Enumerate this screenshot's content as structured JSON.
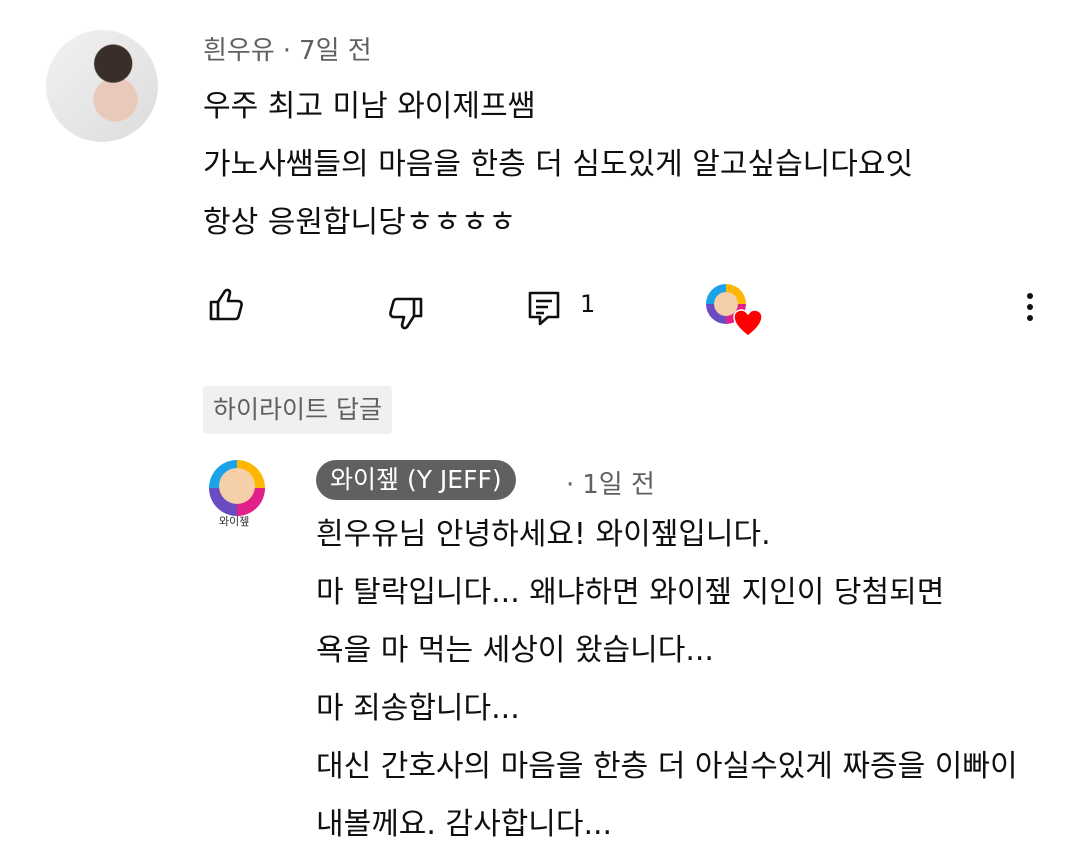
{
  "comment": {
    "author": "흰우유",
    "separator": "·",
    "time": "7일 전",
    "lines": [
      "우주 최고 미남 와이제프쌤",
      "가노사쌤들의 마음을 한층 더 심도있게 알고싶습니다요잇",
      "항상 응원합니당ㅎㅎㅎㅎ"
    ],
    "reply_count": "1",
    "icons": {
      "like": "thumb-up-icon",
      "dislike": "thumb-down-icon",
      "reply": "comment-icon",
      "creator_heart": "heart-icon",
      "more": "more-vert-icon"
    }
  },
  "highlight_label": "하이라이트 답글",
  "reply": {
    "author": "와이젶 (Y JEFF)",
    "avatar_label": "와이젶",
    "separator": "·",
    "time": "1일 전",
    "lines": [
      "흰우유님 안녕하세요! 와이젶입니다.",
      "마 탈락입니다... 왜냐하면 와이젶 지인이 당첨되면",
      "욕을 마 먹는 세상이 왔습니다...",
      "마 죄송합니다...",
      "대신 간호사의 마음을 한층 더 아실수있게 짜증을 이빠이",
      "내볼께요. 감사합니다..."
    ]
  },
  "colors": {
    "text_primary": "#0f0f0f",
    "text_secondary": "#606060",
    "pill_bg": "#606060",
    "badge_bg": "#f0f0f0",
    "heart": "#ff0000"
  }
}
